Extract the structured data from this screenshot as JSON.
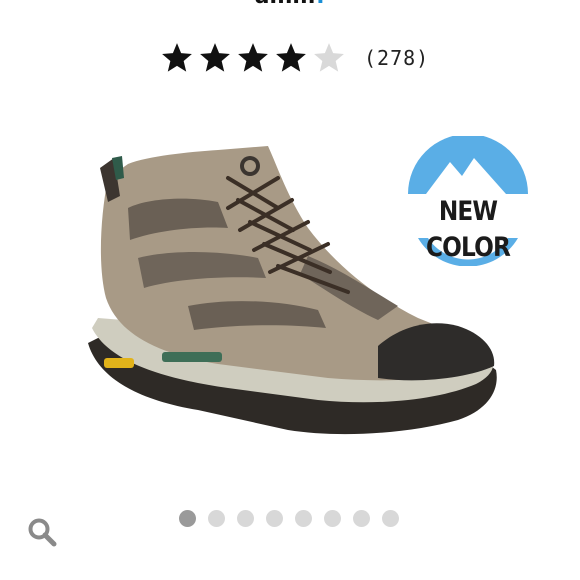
{
  "header": {
    "title_fragment": "amm",
    "title_accent": "!"
  },
  "rating": {
    "stars_filled": 4,
    "stars_total": 5,
    "review_count": "(278)"
  },
  "product": {
    "image_icon": "hiking-boot-image",
    "badge": {
      "text": "NEW COLOR",
      "icon": "mountain-badge-icon",
      "color": "#5aaee6"
    }
  },
  "carousel": {
    "total": 8,
    "active_index": 0
  },
  "search": {
    "icon": "search-icon"
  },
  "colors": {
    "star_filled": "#111111",
    "star_empty": "#d9d9d9",
    "dot_active": "#9a9a9a",
    "dot_inactive": "#d8d8d8"
  }
}
